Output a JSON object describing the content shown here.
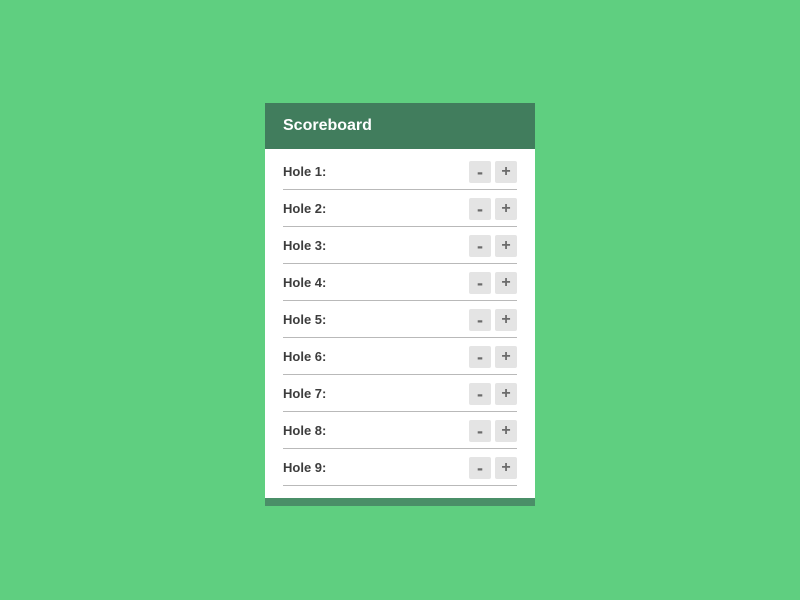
{
  "card": {
    "title": "Scoreboard",
    "minus_label": "-",
    "plus_label": "+",
    "holes": [
      {
        "label": "Hole 1:"
      },
      {
        "label": "Hole 2:"
      },
      {
        "label": "Hole 3:"
      },
      {
        "label": "Hole 4:"
      },
      {
        "label": "Hole 5:"
      },
      {
        "label": "Hole 6:"
      },
      {
        "label": "Hole 7:"
      },
      {
        "label": "Hole 8:"
      },
      {
        "label": "Hole 9:"
      }
    ]
  }
}
